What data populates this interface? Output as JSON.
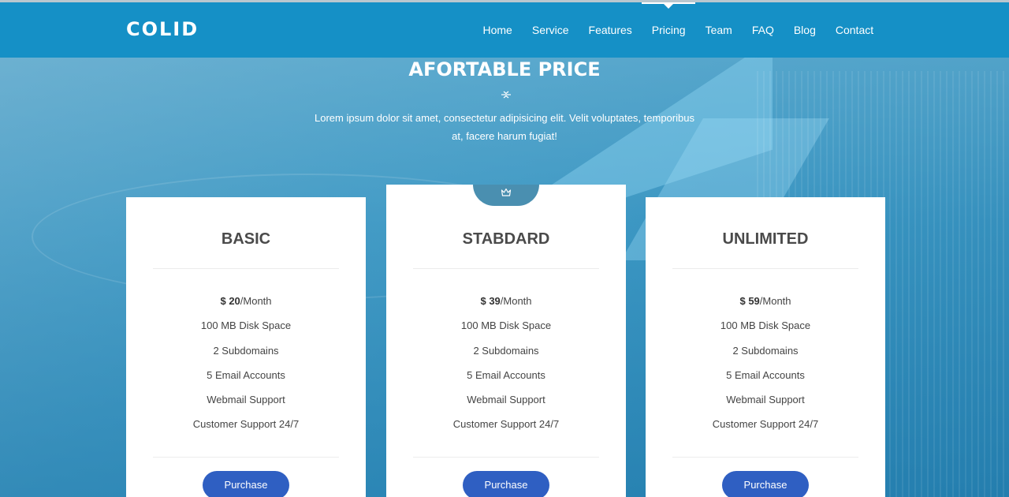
{
  "brand": "COLID",
  "nav": [
    {
      "label": "Home",
      "active": false
    },
    {
      "label": "Service",
      "active": false
    },
    {
      "label": "Features",
      "active": false
    },
    {
      "label": "Pricing",
      "active": true
    },
    {
      "label": "Team",
      "active": false
    },
    {
      "label": "FAQ",
      "active": false
    },
    {
      "label": "Blog",
      "active": false
    },
    {
      "label": "Contact",
      "active": false
    }
  ],
  "section": {
    "title": "AFORTABLE PRICE",
    "icon": "divider-arrows-icon",
    "description": "Lorem ipsum dolor sit amet, consectetur adipisicing elit. Velit voluptates, temporibus at, facere harum fugiat!"
  },
  "plans": [
    {
      "name": "BASIC",
      "currency": "$",
      "price": "20",
      "period": "/Month",
      "features": [
        "100 MB Disk Space",
        "2 Subdomains",
        "5 Email Accounts",
        "Webmail Support",
        "Customer Support 24/7"
      ],
      "button": "Purchase"
    },
    {
      "name": "STABDARD",
      "currency": "$",
      "price": "39",
      "period": "/Month",
      "badge_icon": "crown-icon",
      "features": [
        "100 MB Disk Space",
        "2 Subdomains",
        "5 Email Accounts",
        "Webmail Support",
        "Customer Support 24/7"
      ],
      "button": "Purchase"
    },
    {
      "name": "UNLIMITED",
      "currency": "$",
      "price": "59",
      "period": "/Month",
      "features": [
        "100 MB Disk Space",
        "2 Subdomains",
        "5 Email Accounts",
        "Webmail Support",
        "Customer Support 24/7"
      ],
      "button": "Purchase"
    }
  ],
  "colors": {
    "navbar": "#1590c6",
    "button": "#2f5fc2",
    "badge": "#4a8fb0"
  }
}
